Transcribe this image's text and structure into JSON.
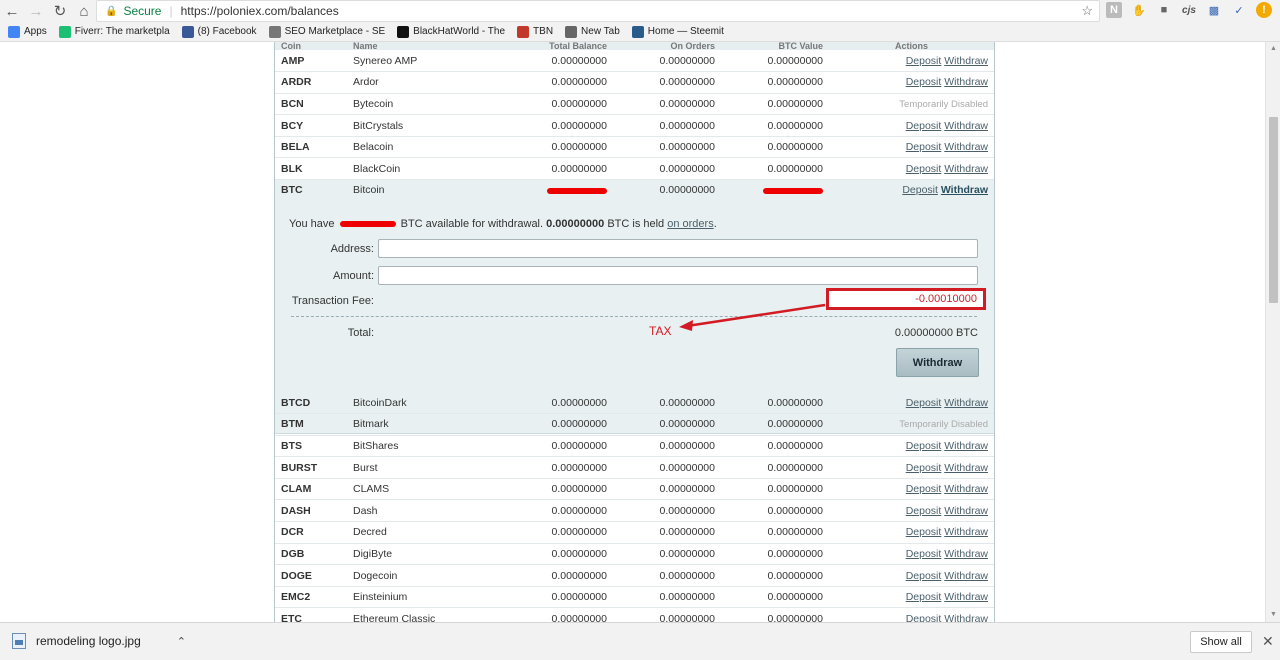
{
  "browser": {
    "secure_label": "Secure",
    "url": "https://poloniex.com/balances",
    "bookmarks": [
      {
        "label": "Apps",
        "color": "#4285f4"
      },
      {
        "label": "Fiverr: The marketpla",
        "color": "#1dbf73"
      },
      {
        "label": "(8) Facebook",
        "color": "#3b5998"
      },
      {
        "label": "SEO Marketplace - SE",
        "color": "#777777"
      },
      {
        "label": "BlackHatWorld - The",
        "color": "#111111"
      },
      {
        "label": "TBN",
        "color": "#c0392b"
      },
      {
        "label": "New Tab",
        "color": "#666666"
      },
      {
        "label": "Home — Steemit",
        "color": "#2a5a8a"
      }
    ],
    "ext_cjs": "cjs"
  },
  "table": {
    "headers": [
      "Coin",
      "Name",
      "Total Balance",
      "On Orders",
      "BTC Value",
      "Actions"
    ],
    "deposit_label": "Deposit",
    "withdraw_label": "Withdraw",
    "disabled_label": "Temporarily Disabled",
    "rows_upper": [
      {
        "coin": "AMP",
        "name": "Synereo AMP",
        "total": "0.00000000",
        "orders": "0.00000000",
        "btc": "0.00000000",
        "disabled": false
      },
      {
        "coin": "ARDR",
        "name": "Ardor",
        "total": "0.00000000",
        "orders": "0.00000000",
        "btc": "0.00000000",
        "disabled": false
      },
      {
        "coin": "BCN",
        "name": "Bytecoin",
        "total": "0.00000000",
        "orders": "0.00000000",
        "btc": "0.00000000",
        "disabled": true
      },
      {
        "coin": "BCY",
        "name": "BitCrystals",
        "total": "0.00000000",
        "orders": "0.00000000",
        "btc": "0.00000000",
        "disabled": false
      },
      {
        "coin": "BELA",
        "name": "Belacoin",
        "total": "0.00000000",
        "orders": "0.00000000",
        "btc": "0.00000000",
        "disabled": false
      },
      {
        "coin": "BLK",
        "name": "BlackCoin",
        "total": "0.00000000",
        "orders": "0.00000000",
        "btc": "0.00000000",
        "disabled": false
      }
    ],
    "btc_row": {
      "coin": "BTC",
      "name": "Bitcoin",
      "orders": "0.00000000"
    },
    "rows_lower": [
      {
        "coin": "BTCD",
        "name": "BitcoinDark",
        "total": "0.00000000",
        "orders": "0.00000000",
        "btc": "0.00000000",
        "disabled": false
      },
      {
        "coin": "BTM",
        "name": "Bitmark",
        "total": "0.00000000",
        "orders": "0.00000000",
        "btc": "0.00000000",
        "disabled": true
      },
      {
        "coin": "BTS",
        "name": "BitShares",
        "total": "0.00000000",
        "orders": "0.00000000",
        "btc": "0.00000000",
        "disabled": false
      },
      {
        "coin": "BURST",
        "name": "Burst",
        "total": "0.00000000",
        "orders": "0.00000000",
        "btc": "0.00000000",
        "disabled": false
      },
      {
        "coin": "CLAM",
        "name": "CLAMS",
        "total": "0.00000000",
        "orders": "0.00000000",
        "btc": "0.00000000",
        "disabled": false
      },
      {
        "coin": "DASH",
        "name": "Dash",
        "total": "0.00000000",
        "orders": "0.00000000",
        "btc": "0.00000000",
        "disabled": false
      },
      {
        "coin": "DCR",
        "name": "Decred",
        "total": "0.00000000",
        "orders": "0.00000000",
        "btc": "0.00000000",
        "disabled": false
      },
      {
        "coin": "DGB",
        "name": "DigiByte",
        "total": "0.00000000",
        "orders": "0.00000000",
        "btc": "0.00000000",
        "disabled": false
      },
      {
        "coin": "DOGE",
        "name": "Dogecoin",
        "total": "0.00000000",
        "orders": "0.00000000",
        "btc": "0.00000000",
        "disabled": false
      },
      {
        "coin": "EMC2",
        "name": "Einsteinium",
        "total": "0.00000000",
        "orders": "0.00000000",
        "btc": "0.00000000",
        "disabled": false
      },
      {
        "coin": "ETC",
        "name": "Ethereum Classic",
        "total": "0.00000000",
        "orders": "0.00000000",
        "btc": "0.00000000",
        "disabled": false
      }
    ]
  },
  "withdraw_panel": {
    "you_have": "You have",
    "available_text": "BTC available for withdrawal.",
    "held_amount": "0.00000000",
    "held_text": "BTC is held",
    "on_orders_link": "on orders",
    "period": ".",
    "address_label": "Address:",
    "amount_label": "Amount:",
    "fee_label": "Transaction Fee:",
    "fee_value": "-0.00010000",
    "total_label": "Total:",
    "total_value": "0.00000000 BTC",
    "withdraw_button": "Withdraw",
    "annotation": "TAX"
  },
  "downloads": {
    "file_name": "remodeling logo.jpg",
    "show_all": "Show all"
  }
}
